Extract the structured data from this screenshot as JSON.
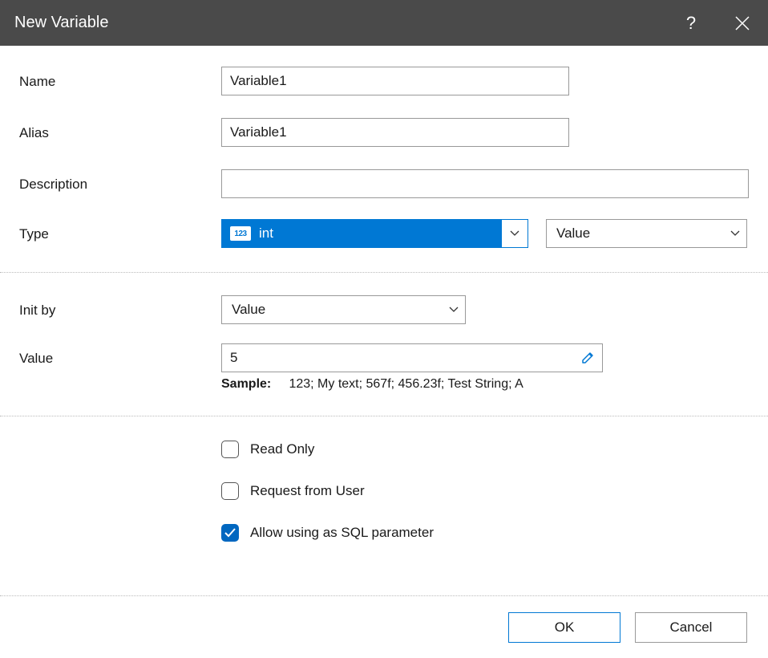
{
  "dialog": {
    "title": "New Variable"
  },
  "labels": {
    "name": "Name",
    "alias": "Alias",
    "description": "Description",
    "type": "Type",
    "init_by": "Init by",
    "value": "Value",
    "sample_label": "Sample:",
    "sample_text": "123; My text; 567f; 456.23f; Test String; A"
  },
  "fields": {
    "name": "Variable1",
    "alias": "Variable1",
    "description": "",
    "type": "int",
    "type_badge": "123",
    "type_mode": "Value",
    "init_by": "Value",
    "value": "5"
  },
  "checkboxes": {
    "read_only": {
      "label": "Read Only",
      "checked": false
    },
    "request_from_user": {
      "label": "Request from User",
      "checked": false
    },
    "allow_sql": {
      "label": "Allow using as SQL parameter",
      "checked": true
    }
  },
  "buttons": {
    "ok": "OK",
    "cancel": "Cancel"
  }
}
